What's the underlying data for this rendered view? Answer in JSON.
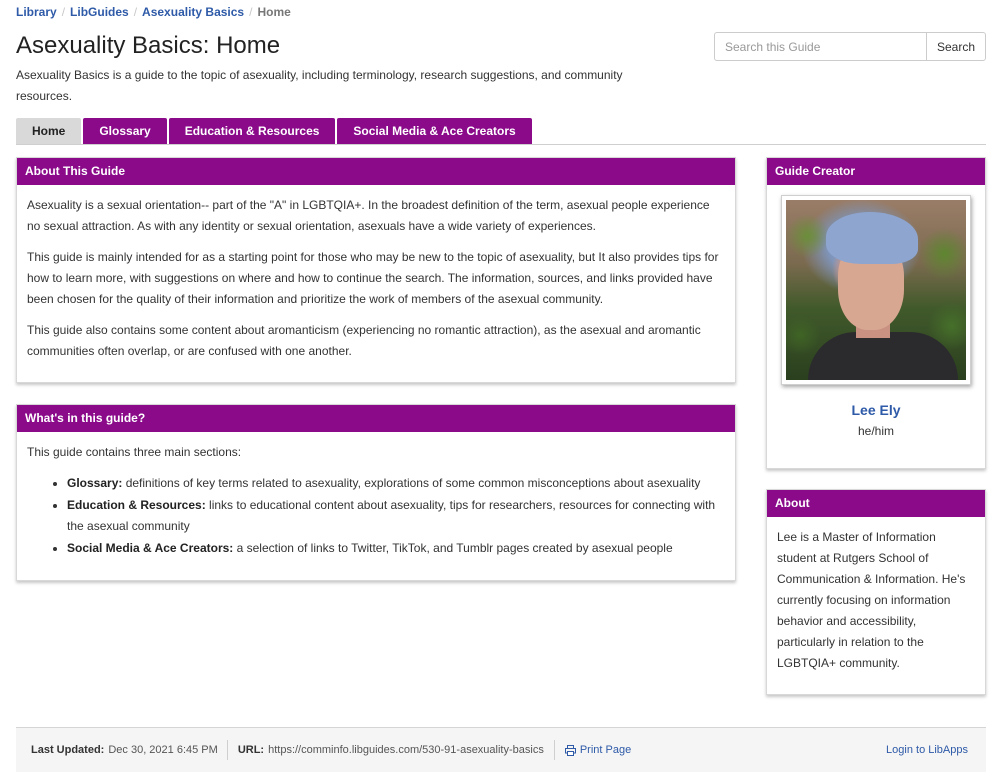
{
  "breadcrumb": {
    "items": [
      "Library",
      "LibGuides",
      "Asexuality Basics"
    ],
    "current": "Home",
    "separator": "/"
  },
  "page": {
    "title": "Asexuality Basics: Home",
    "description": "Asexuality Basics is a guide to the topic of asexuality, including terminology, research suggestions, and community resources."
  },
  "search": {
    "placeholder": "Search this Guide",
    "button_label": "Search"
  },
  "tabs": [
    {
      "label": "Home",
      "active": true
    },
    {
      "label": "Glossary",
      "active": false
    },
    {
      "label": "Education & Resources",
      "active": false
    },
    {
      "label": "Social Media & Ace Creators",
      "active": false
    }
  ],
  "about_guide": {
    "header": "About This Guide",
    "paragraphs": [
      "Asexuality is a sexual orientation-- part of the \"A\" in LGBTQIA+. In the broadest definition of the term, asexual people experience no sexual attraction. As with any identity or sexual orientation, asexuals have a wide variety of experiences.",
      "This guide is mainly intended for as a starting point for those who may be new to the topic of asexuality, but It also provides tips for how to learn more, with suggestions on where and how to continue the search. The information, sources, and links provided have been chosen for the quality of their information and prioritize the work of members of the asexual community.",
      "This guide also contains some content about aromanticism (experiencing no romantic attraction), as the asexual and aromantic communities often overlap, or are confused with one another."
    ]
  },
  "whats_in_guide": {
    "header": "What's in this guide?",
    "intro": "This guide contains three main sections:",
    "items": [
      {
        "term": "Glossary:",
        "text": " definitions of key terms related to asexuality, explorations of some common misconceptions about asexuality"
      },
      {
        "term": "Education & Resources:",
        "text": " links to educational content about asexuality, tips for researchers, resources for connecting with the asexual community"
      },
      {
        "term": "Social Media & Ace Creators:",
        "text": " a selection of links to Twitter, TikTok, and Tumblr pages created by asexual people"
      }
    ]
  },
  "guide_creator": {
    "header": "Guide Creator",
    "name": "Lee Ely",
    "pronouns": "he/him"
  },
  "about_creator": {
    "header": "About",
    "text": "Lee is a Master of Information student at Rutgers School of Communication & Information. He's currently focusing on information behavior and accessibility, particularly in relation to the LGBTQIA+ community."
  },
  "footer": {
    "last_updated_label": "Last Updated:",
    "last_updated_value": "Dec 30, 2021 6:45 PM",
    "url_label": "URL:",
    "url_value": "https://comminfo.libguides.com/530-91-asexuality-basics",
    "print_label": "Print Page",
    "login_label": "Login to LibApps"
  },
  "colors": {
    "brand_purple": "#8a0a8a",
    "link_blue": "#2e5aa8",
    "active_tab_gray": "#d9d9d9"
  },
  "icons": {
    "print": "print-icon"
  }
}
